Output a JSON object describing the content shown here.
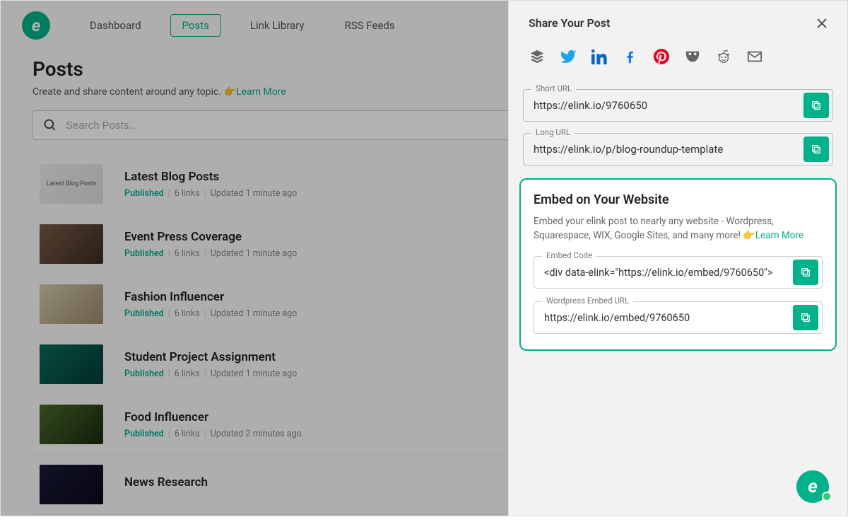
{
  "brand": {
    "glyph": "e"
  },
  "nav": {
    "items": [
      "Dashboard",
      "Posts",
      "Link Library",
      "RSS Feeds"
    ],
    "active_index": 1
  },
  "page": {
    "title": "Posts",
    "subtitle": "Create and share content around any topic.",
    "learn_more": "Learn More",
    "search_placeholder": "Search Posts..."
  },
  "posts": [
    {
      "title": "Latest Blog Posts",
      "status": "Published",
      "links": "6 links",
      "updated": "Updated 1 minute ago",
      "thumb_text": "Latest\nBlog Posts"
    },
    {
      "title": "Event Press Coverage",
      "status": "Published",
      "links": "6 links",
      "updated": "Updated 1 minute ago"
    },
    {
      "title": "Fashion Influencer",
      "status": "Published",
      "links": "6 links",
      "updated": "Updated 1 minute ago"
    },
    {
      "title": "Student Project Assignment",
      "status": "Published",
      "links": "6 links",
      "updated": "Updated 1 minute ago"
    },
    {
      "title": "Food Influencer",
      "status": "Published",
      "links": "6 links",
      "updated": "Updated 2 minutes ago"
    },
    {
      "title": "News Research",
      "status": "",
      "links": "",
      "updated": ""
    }
  ],
  "panel": {
    "title": "Share Your Post",
    "social": [
      "buffer",
      "twitter",
      "linkedin",
      "facebook",
      "pinterest",
      "hootsuite",
      "reddit",
      "email"
    ],
    "short_url": {
      "label": "Short URL",
      "value": "https://elink.io/9760650"
    },
    "long_url": {
      "label": "Long URL",
      "value": "https://elink.io/p/blog-roundup-template"
    },
    "embed": {
      "title": "Embed on Your Website",
      "desc": "Embed your elink post to nearly any website - Wordpress, Squarespace, WIX, Google Sites, and many more!",
      "learn_more": "Learn More",
      "code": {
        "label": "Embed Code",
        "value": "<div data-elink=\"https://elink.io/embed/9760650\">"
      },
      "wp": {
        "label": "Wordpress Embed URL",
        "value": "https://elink.io/embed/9760650"
      }
    }
  }
}
